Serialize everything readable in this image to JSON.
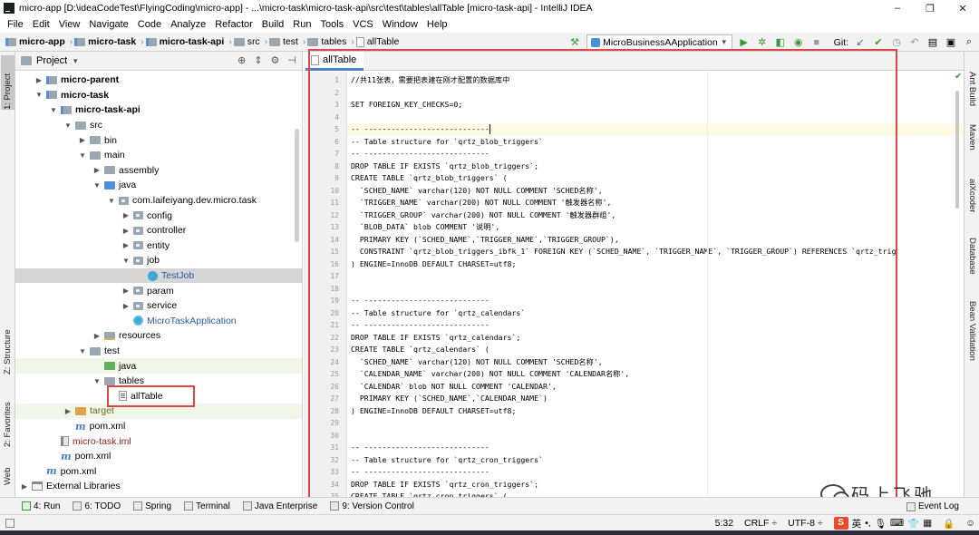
{
  "window": {
    "title": "micro-app [D:\\ideaCodeTest\\FlyingCoding\\micro-app] - ...\\micro-task\\micro-task-api\\src\\test\\tables\\allTable [micro-task-api] - IntelliJ IDEA",
    "minimize": "–",
    "maximize": "❐",
    "close": "✕"
  },
  "menu": [
    "File",
    "Edit",
    "View",
    "Navigate",
    "Code",
    "Analyze",
    "Refactor",
    "Build",
    "Run",
    "Tools",
    "VCS",
    "Window",
    "Help"
  ],
  "breadcrumb": [
    "micro-app",
    "micro-task",
    "micro-task-api",
    "src",
    "test",
    "tables",
    "allTable"
  ],
  "toolbar": {
    "run_config": "MicroBusinessAApplication",
    "git_label": "Git:"
  },
  "left_tool_tabs": {
    "project": "1: Project",
    "structure": "Z: Structure",
    "favorites": "2: Favorites",
    "web": "Web"
  },
  "right_tool_tabs": {
    "ant": "Ant Build",
    "maven": "Maven",
    "aixcoder": "aiXcoder",
    "database": "Database",
    "bean": "Bean Validation"
  },
  "project_panel": {
    "title": "Project",
    "tree": [
      {
        "label": "micro-parent",
        "depth": 1,
        "arrow": "right",
        "icon": "mod",
        "style": "bold"
      },
      {
        "label": "micro-task",
        "depth": 1,
        "arrow": "down",
        "icon": "mod",
        "style": "bold"
      },
      {
        "label": "micro-task-api",
        "depth": 2,
        "arrow": "down",
        "icon": "mod",
        "style": "bold"
      },
      {
        "label": "src",
        "depth": 3,
        "arrow": "down",
        "icon": "fold"
      },
      {
        "label": "bin",
        "depth": 4,
        "arrow": "right",
        "icon": "fold"
      },
      {
        "label": "main",
        "depth": 4,
        "arrow": "down",
        "icon": "fold"
      },
      {
        "label": "assembly",
        "depth": 5,
        "arrow": "right",
        "icon": "fold"
      },
      {
        "label": "java",
        "depth": 5,
        "arrow": "down",
        "icon": "fold src"
      },
      {
        "label": "com.laifeiyang.dev.micro.task",
        "depth": 6,
        "arrow": "down",
        "icon": "pkg"
      },
      {
        "label": "config",
        "depth": 7,
        "arrow": "right",
        "icon": "pkg"
      },
      {
        "label": "controller",
        "depth": 7,
        "arrow": "right",
        "icon": "pkg"
      },
      {
        "label": "entity",
        "depth": 7,
        "arrow": "right",
        "icon": "pkg"
      },
      {
        "label": "job",
        "depth": 7,
        "arrow": "down",
        "icon": "pkg"
      },
      {
        "label": "TestJob",
        "depth": 8,
        "arrow": "",
        "icon": "cls",
        "style": "blue",
        "row": "sel"
      },
      {
        "label": "param",
        "depth": 7,
        "arrow": "right",
        "icon": "pkg"
      },
      {
        "label": "service",
        "depth": 7,
        "arrow": "right",
        "icon": "pkg"
      },
      {
        "label": "MicroTaskApplication",
        "depth": 7,
        "arrow": "",
        "icon": "cls main",
        "style": "blue"
      },
      {
        "label": "resources",
        "depth": 5,
        "arrow": "right",
        "icon": "fold res"
      },
      {
        "label": "test",
        "depth": 4,
        "arrow": "down",
        "icon": "fold"
      },
      {
        "label": "java",
        "depth": 5,
        "arrow": "",
        "icon": "fold test",
        "row": "hl"
      },
      {
        "label": "tables",
        "depth": 5,
        "arrow": "down",
        "icon": "fold"
      },
      {
        "label": "allTable",
        "depth": 6,
        "arrow": "",
        "icon": "file"
      },
      {
        "label": "target",
        "depth": 3,
        "arrow": "right",
        "icon": "fold tgt",
        "style": "olive",
        "row": "hl"
      },
      {
        "label": "pom.xml",
        "depth": 3,
        "arrow": "",
        "icon": "mvn"
      },
      {
        "label": "micro-task.iml",
        "depth": 2,
        "arrow": "",
        "icon": "iml",
        "style": "iml"
      },
      {
        "label": "pom.xml",
        "depth": 2,
        "arrow": "",
        "icon": "mvn"
      },
      {
        "label": "pom.xml",
        "depth": 1,
        "arrow": "",
        "icon": "mvn"
      },
      {
        "label": "External Libraries",
        "depth": 0,
        "arrow": "right",
        "icon": "lib"
      }
    ]
  },
  "editor": {
    "tab": "allTable",
    "current_line": 5,
    "lines": [
      "//共11张表，需要把表建在刚才配置的数据库中",
      "",
      "SET FOREIGN_KEY_CHECKS=0;",
      "",
      "-- ----------------------------",
      "-- Table structure for `qrtz_blob_triggers`",
      "-- ----------------------------",
      "DROP TABLE IF EXISTS `qrtz_blob_triggers`;",
      "CREATE TABLE `qrtz_blob_triggers` (",
      "  `SCHED_NAME` varchar(120) NOT NULL COMMENT 'SCHED名称',",
      "  `TRIGGER_NAME` varchar(200) NOT NULL COMMENT '触发器名称',",
      "  `TRIGGER_GROUP` varchar(200) NOT NULL COMMENT '触发器群组',",
      "  `BLOB_DATA` blob COMMENT '说明',",
      "  PRIMARY KEY (`SCHED_NAME`,`TRIGGER_NAME`,`TRIGGER_GROUP`),",
      "  CONSTRAINT `qrtz_blob_triggers_ibfk_1` FOREIGN KEY (`SCHED_NAME`, `TRIGGER_NAME`, `TRIGGER_GROUP`) REFERENCES `qrtz_trig",
      ") ENGINE=InnoDB DEFAULT CHARSET=utf8;",
      "",
      "",
      "-- ----------------------------",
      "-- Table structure for `qrtz_calendars`",
      "-- ----------------------------",
      "DROP TABLE IF EXISTS `qrtz_calendars`;",
      "CREATE TABLE `qrtz_calendars` (",
      "  `SCHED_NAME` varchar(120) NOT NULL COMMENT 'SCHED名称',",
      "  `CALENDAR_NAME` varchar(200) NOT NULL COMMENT 'CALENDAR名称',",
      "  `CALENDAR` blob NOT NULL COMMENT 'CALENDAR',",
      "  PRIMARY KEY (`SCHED_NAME`,`CALENDAR_NAME`)",
      ") ENGINE=InnoDB DEFAULT CHARSET=utf8;",
      "",
      "",
      "-- ----------------------------",
      "-- Table structure for `qrtz_cron_triggers`",
      "-- ----------------------------",
      "DROP TABLE IF EXISTS `qrtz_cron_triggers`;",
      "CREATE TABLE `qrtz_cron_triggers` ("
    ]
  },
  "tool_windows": [
    "4: Run",
    "6: TODO",
    "Spring",
    "Terminal",
    "Java Enterprise",
    "9: Version Control"
  ],
  "event_log": "Event Log",
  "status": {
    "position": "5:32",
    "line_sep": "CRLF",
    "encoding": "UTF-8",
    "ime": "英"
  },
  "watermark": "码上飞驰"
}
